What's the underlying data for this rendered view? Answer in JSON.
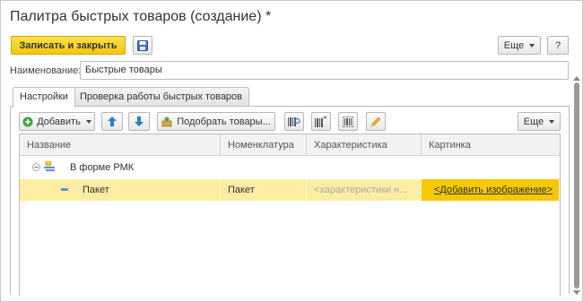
{
  "window": {
    "title": "Палитра быстрых товаров (создание) *"
  },
  "toolbar": {
    "save_close_label": "Записать и закрыть",
    "more_label": "Еще",
    "help_label": "?"
  },
  "name_field": {
    "label": "Наименование:",
    "value": "Быстрые товары"
  },
  "tabs": [
    {
      "label": "Настройки",
      "active": true
    },
    {
      "label": "Проверка работы быстрых товаров",
      "active": false
    }
  ],
  "panel_toolbar": {
    "add_label": "Добавить",
    "pick_goods_label": "Подобрать товары...",
    "more_label": "Еще"
  },
  "grid": {
    "columns": [
      "Название",
      "Номенклатура",
      "Характеристика",
      "Картинка"
    ],
    "group_row": {
      "name": "В форме РМК"
    },
    "rows": [
      {
        "name": "Пакет",
        "nomenclature": "Пакет",
        "characteristic": "<характеристики н...",
        "picture": "<Добавить изображение>"
      }
    ]
  },
  "colors": {
    "accent_yellow": "#f5c800",
    "selected_row": "#fbeea2",
    "add_icon_green": "#3aa53a",
    "arrow_blue": "#2a7fd4"
  }
}
